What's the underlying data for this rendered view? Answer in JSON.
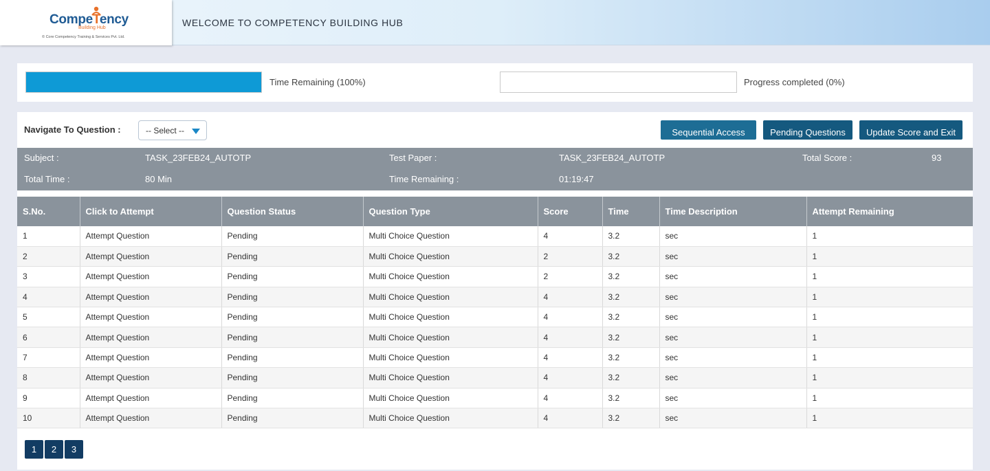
{
  "header": {
    "logo_prefix": "Compe",
    "logo_accent": "T",
    "logo_suffix": "ency",
    "logo_subtitle": "Building Hub",
    "logo_tagline": "© Core Competency Training & Services Pvt. Ltd.",
    "title": "WELCOME TO COMPETENCY BUILDING HUB"
  },
  "progress": {
    "time_remaining_label": "Time Remaining (100%)",
    "time_remaining_fraction": 1.0,
    "progress_label": "Progress completed (0%)",
    "progress_fraction": 0.0,
    "fill_color": "#0e9ad6"
  },
  "nav": {
    "label": "Navigate To Question :",
    "select_value": "-- Select --"
  },
  "buttons": {
    "sequential": "Sequential Access",
    "pending": "Pending Questions",
    "update": "Update Score and Exit"
  },
  "info": {
    "subject_label": "Subject :",
    "subject_value": "TASK_23FEB24_AUTOTP",
    "paper_label": "Test Paper :",
    "paper_value": "TASK_23FEB24_AUTOTP",
    "score_label": "Total Score :",
    "score_value": "93",
    "total_time_label": "Total Time :",
    "total_time_value": "80 Min",
    "time_remaining_label": "Time Remaining :",
    "time_remaining_value": "01:19:47"
  },
  "table": {
    "headers": [
      "S.No.",
      "Click to Attempt",
      "Question Status",
      "Question Type",
      "Score",
      "Time",
      "Time Description",
      "Attempt Remaining"
    ],
    "rows": [
      [
        "1",
        "Attempt Question",
        "Pending",
        "Multi Choice Question",
        "4",
        "3.2",
        "sec",
        "1"
      ],
      [
        "2",
        "Attempt Question",
        "Pending",
        "Multi Choice Question",
        "2",
        "3.2",
        "sec",
        "1"
      ],
      [
        "3",
        "Attempt Question",
        "Pending",
        "Multi Choice Question",
        "2",
        "3.2",
        "sec",
        "1"
      ],
      [
        "4",
        "Attempt Question",
        "Pending",
        "Multi Choice Question",
        "4",
        "3.2",
        "sec",
        "1"
      ],
      [
        "5",
        "Attempt Question",
        "Pending",
        "Multi Choice Question",
        "4",
        "3.2",
        "sec",
        "1"
      ],
      [
        "6",
        "Attempt Question",
        "Pending",
        "Multi Choice Question",
        "4",
        "3.2",
        "sec",
        "1"
      ],
      [
        "7",
        "Attempt Question",
        "Pending",
        "Multi Choice Question",
        "4",
        "3.2",
        "sec",
        "1"
      ],
      [
        "8",
        "Attempt Question",
        "Pending",
        "Multi Choice Question",
        "4",
        "3.2",
        "sec",
        "1"
      ],
      [
        "9",
        "Attempt Question",
        "Pending",
        "Multi Choice Question",
        "4",
        "3.2",
        "sec",
        "1"
      ],
      [
        "10",
        "Attempt Question",
        "Pending",
        "Multi Choice Question",
        "4",
        "3.2",
        "sec",
        "1"
      ]
    ]
  },
  "pagination": [
    "1",
    "2",
    "3"
  ]
}
